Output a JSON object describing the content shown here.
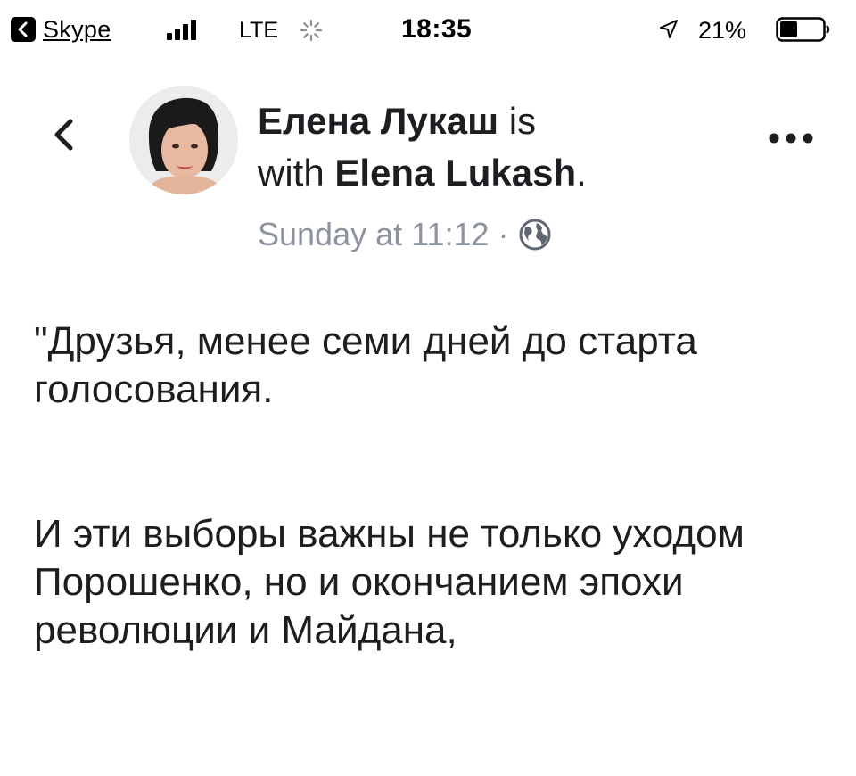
{
  "status_bar": {
    "back_app_label": "Skype",
    "network": "LTE",
    "time": "18:35",
    "battery_percent": "21%",
    "battery_level": 0.21
  },
  "post": {
    "author_name": "Елена Лукаш",
    "is_with_prefix": "is",
    "with_word": "with",
    "tagged_name": "Elena Lukash",
    "period": ".",
    "timestamp": "Sunday at 11:12 ·",
    "privacy_icon": "globe-icon",
    "paragraphs": [
      "\"Друзья, менее семи дней до старта голосования.",
      "И эти выборы важны не только уходом Порошенко, но и окончанием эпохи революции и Майдана,"
    ]
  },
  "icons": {
    "back": "chevron-left-icon",
    "more": "ellipsis-icon",
    "location": "location-arrow-icon"
  },
  "colors": {
    "text": "#1c1e21",
    "secondary_text": "#8d949e"
  }
}
